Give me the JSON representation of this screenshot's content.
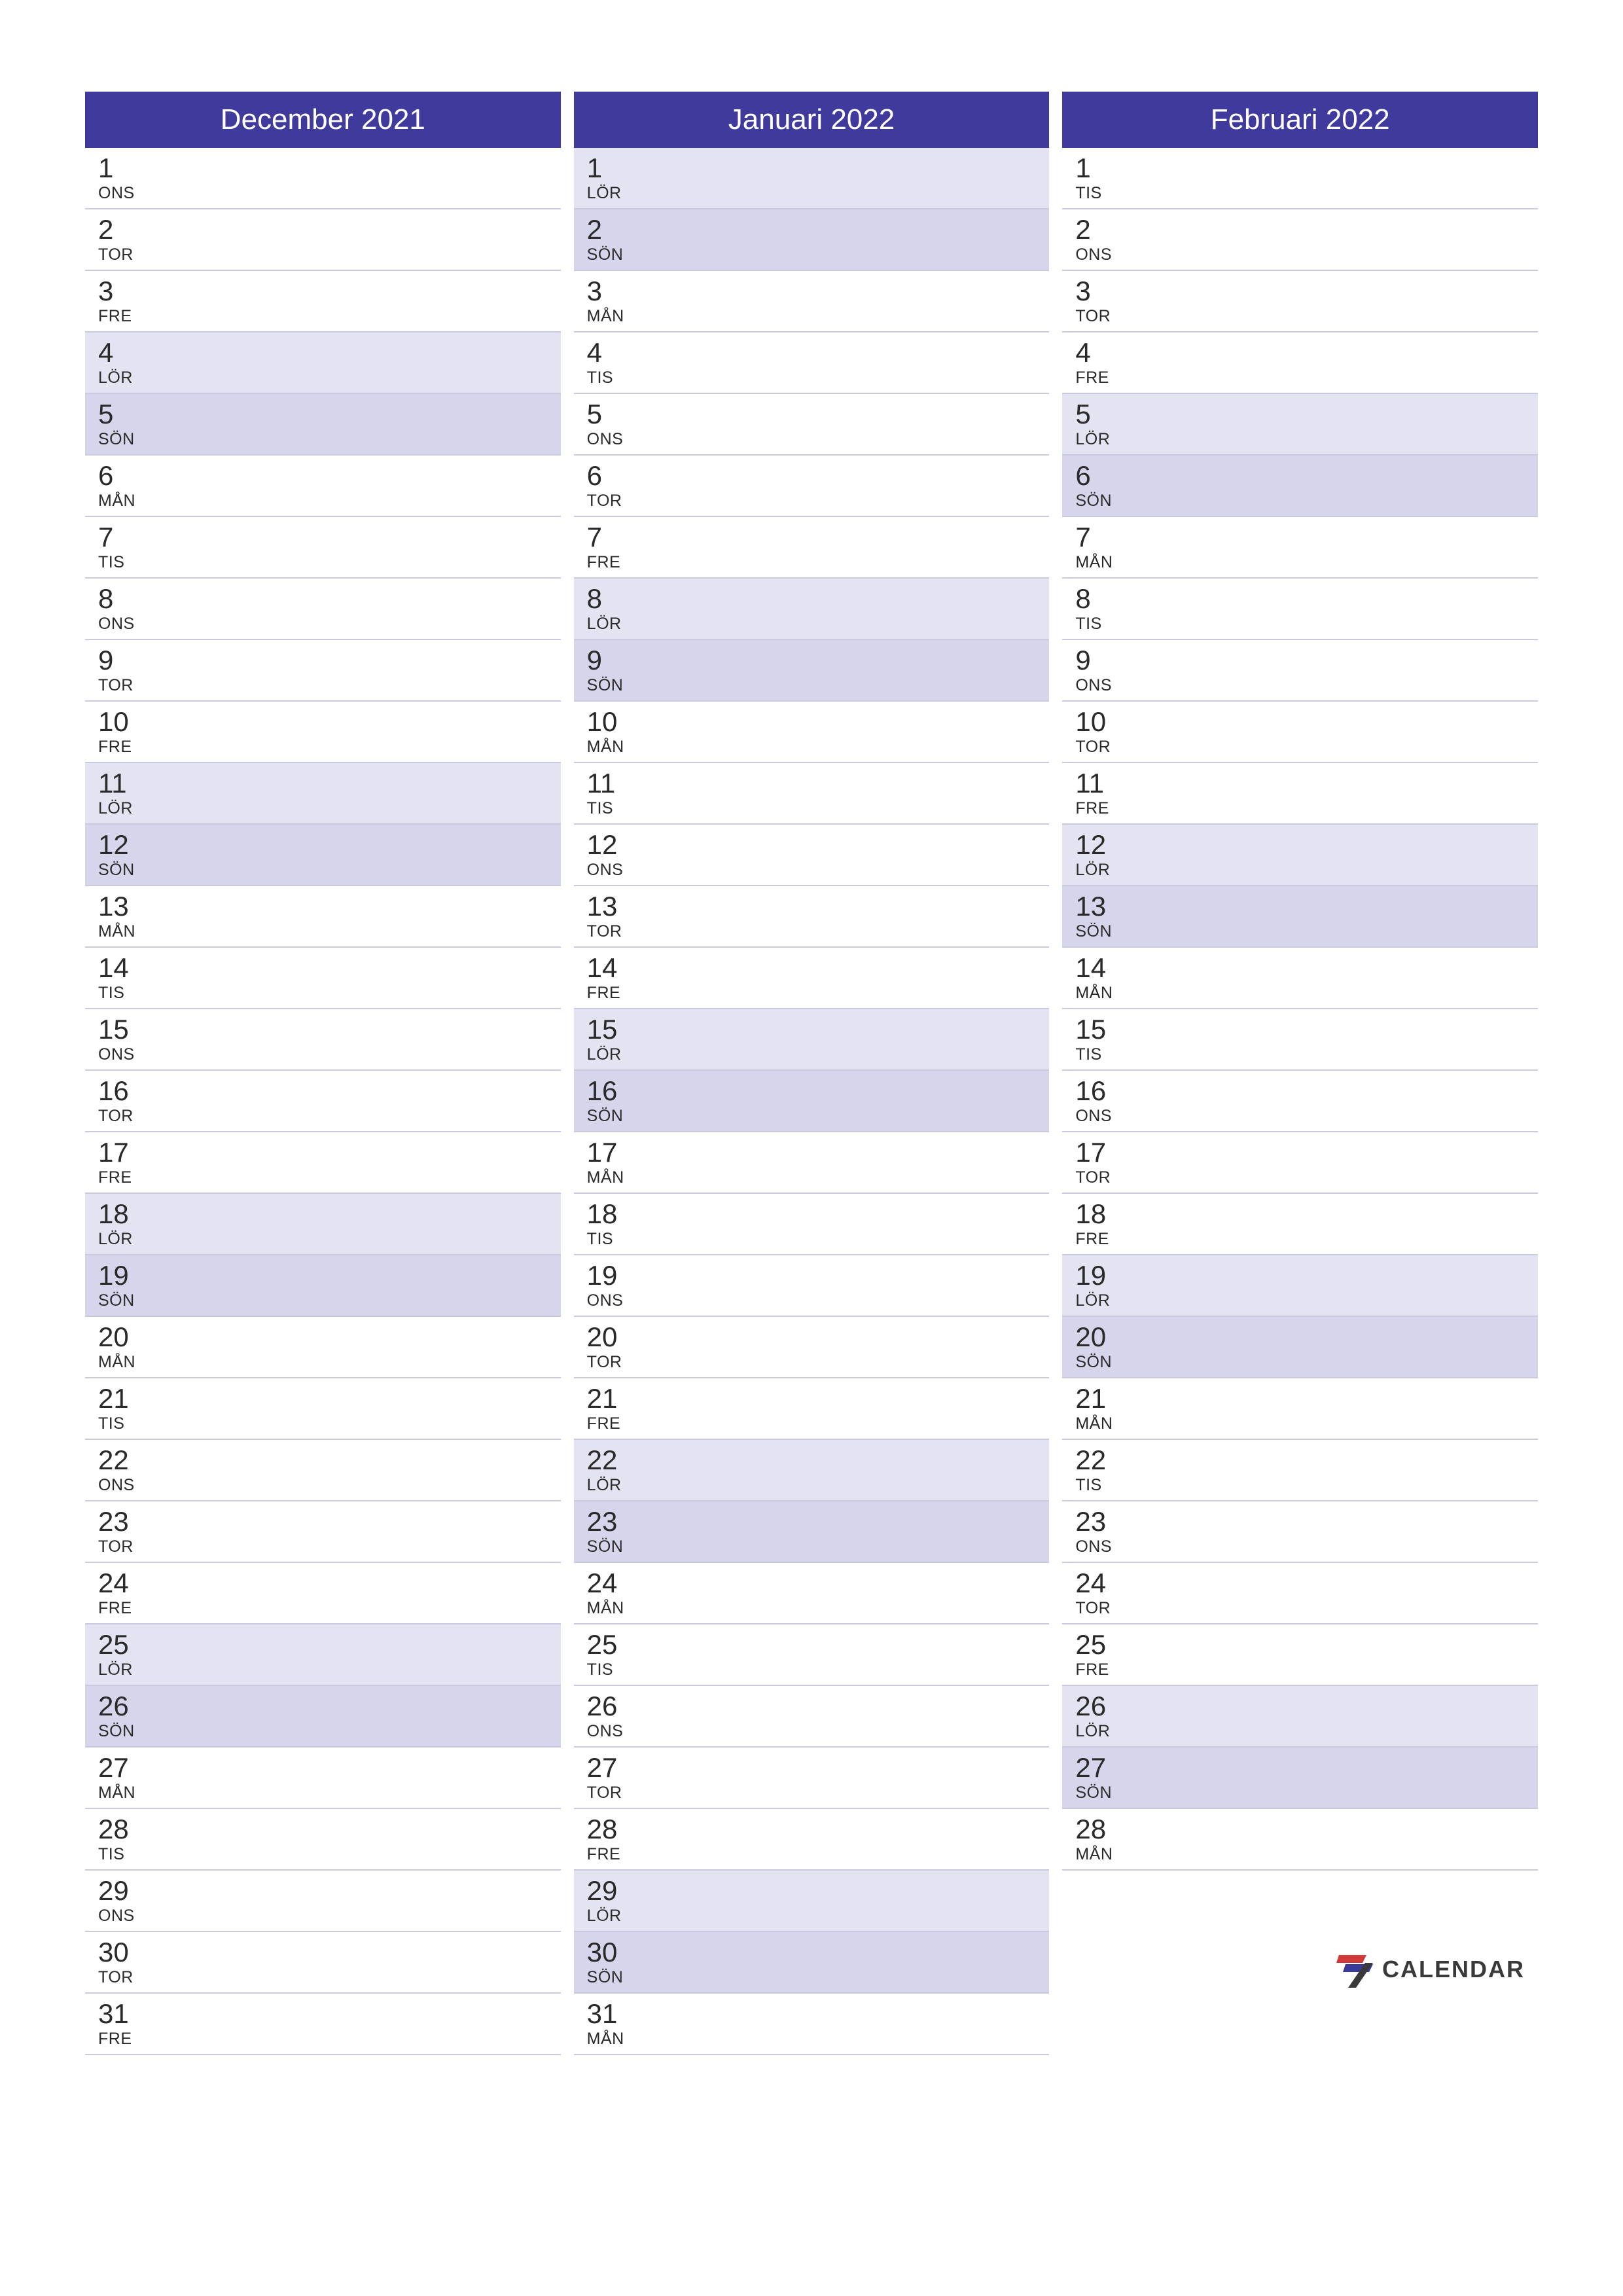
{
  "months": [
    {
      "title": "December 2021",
      "days": [
        {
          "num": "1",
          "name": "ONS",
          "type": ""
        },
        {
          "num": "2",
          "name": "TOR",
          "type": ""
        },
        {
          "num": "3",
          "name": "FRE",
          "type": ""
        },
        {
          "num": "4",
          "name": "LÖR",
          "type": "sat"
        },
        {
          "num": "5",
          "name": "SÖN",
          "type": "sun"
        },
        {
          "num": "6",
          "name": "MÅN",
          "type": ""
        },
        {
          "num": "7",
          "name": "TIS",
          "type": ""
        },
        {
          "num": "8",
          "name": "ONS",
          "type": ""
        },
        {
          "num": "9",
          "name": "TOR",
          "type": ""
        },
        {
          "num": "10",
          "name": "FRE",
          "type": ""
        },
        {
          "num": "11",
          "name": "LÖR",
          "type": "sat"
        },
        {
          "num": "12",
          "name": "SÖN",
          "type": "sun"
        },
        {
          "num": "13",
          "name": "MÅN",
          "type": ""
        },
        {
          "num": "14",
          "name": "TIS",
          "type": ""
        },
        {
          "num": "15",
          "name": "ONS",
          "type": ""
        },
        {
          "num": "16",
          "name": "TOR",
          "type": ""
        },
        {
          "num": "17",
          "name": "FRE",
          "type": ""
        },
        {
          "num": "18",
          "name": "LÖR",
          "type": "sat"
        },
        {
          "num": "19",
          "name": "SÖN",
          "type": "sun"
        },
        {
          "num": "20",
          "name": "MÅN",
          "type": ""
        },
        {
          "num": "21",
          "name": "TIS",
          "type": ""
        },
        {
          "num": "22",
          "name": "ONS",
          "type": ""
        },
        {
          "num": "23",
          "name": "TOR",
          "type": ""
        },
        {
          "num": "24",
          "name": "FRE",
          "type": ""
        },
        {
          "num": "25",
          "name": "LÖR",
          "type": "sat"
        },
        {
          "num": "26",
          "name": "SÖN",
          "type": "sun"
        },
        {
          "num": "27",
          "name": "MÅN",
          "type": ""
        },
        {
          "num": "28",
          "name": "TIS",
          "type": ""
        },
        {
          "num": "29",
          "name": "ONS",
          "type": ""
        },
        {
          "num": "30",
          "name": "TOR",
          "type": ""
        },
        {
          "num": "31",
          "name": "FRE",
          "type": ""
        }
      ]
    },
    {
      "title": "Januari 2022",
      "days": [
        {
          "num": "1",
          "name": "LÖR",
          "type": "sat"
        },
        {
          "num": "2",
          "name": "SÖN",
          "type": "sun"
        },
        {
          "num": "3",
          "name": "MÅN",
          "type": ""
        },
        {
          "num": "4",
          "name": "TIS",
          "type": ""
        },
        {
          "num": "5",
          "name": "ONS",
          "type": ""
        },
        {
          "num": "6",
          "name": "TOR",
          "type": ""
        },
        {
          "num": "7",
          "name": "FRE",
          "type": ""
        },
        {
          "num": "8",
          "name": "LÖR",
          "type": "sat"
        },
        {
          "num": "9",
          "name": "SÖN",
          "type": "sun"
        },
        {
          "num": "10",
          "name": "MÅN",
          "type": ""
        },
        {
          "num": "11",
          "name": "TIS",
          "type": ""
        },
        {
          "num": "12",
          "name": "ONS",
          "type": ""
        },
        {
          "num": "13",
          "name": "TOR",
          "type": ""
        },
        {
          "num": "14",
          "name": "FRE",
          "type": ""
        },
        {
          "num": "15",
          "name": "LÖR",
          "type": "sat"
        },
        {
          "num": "16",
          "name": "SÖN",
          "type": "sun"
        },
        {
          "num": "17",
          "name": "MÅN",
          "type": ""
        },
        {
          "num": "18",
          "name": "TIS",
          "type": ""
        },
        {
          "num": "19",
          "name": "ONS",
          "type": ""
        },
        {
          "num": "20",
          "name": "TOR",
          "type": ""
        },
        {
          "num": "21",
          "name": "FRE",
          "type": ""
        },
        {
          "num": "22",
          "name": "LÖR",
          "type": "sat"
        },
        {
          "num": "23",
          "name": "SÖN",
          "type": "sun"
        },
        {
          "num": "24",
          "name": "MÅN",
          "type": ""
        },
        {
          "num": "25",
          "name": "TIS",
          "type": ""
        },
        {
          "num": "26",
          "name": "ONS",
          "type": ""
        },
        {
          "num": "27",
          "name": "TOR",
          "type": ""
        },
        {
          "num": "28",
          "name": "FRE",
          "type": ""
        },
        {
          "num": "29",
          "name": "LÖR",
          "type": "sat"
        },
        {
          "num": "30",
          "name": "SÖN",
          "type": "sun"
        },
        {
          "num": "31",
          "name": "MÅN",
          "type": ""
        }
      ]
    },
    {
      "title": "Februari 2022",
      "days": [
        {
          "num": "1",
          "name": "TIS",
          "type": ""
        },
        {
          "num": "2",
          "name": "ONS",
          "type": ""
        },
        {
          "num": "3",
          "name": "TOR",
          "type": ""
        },
        {
          "num": "4",
          "name": "FRE",
          "type": ""
        },
        {
          "num": "5",
          "name": "LÖR",
          "type": "sat"
        },
        {
          "num": "6",
          "name": "SÖN",
          "type": "sun"
        },
        {
          "num": "7",
          "name": "MÅN",
          "type": ""
        },
        {
          "num": "8",
          "name": "TIS",
          "type": ""
        },
        {
          "num": "9",
          "name": "ONS",
          "type": ""
        },
        {
          "num": "10",
          "name": "TOR",
          "type": ""
        },
        {
          "num": "11",
          "name": "FRE",
          "type": ""
        },
        {
          "num": "12",
          "name": "LÖR",
          "type": "sat"
        },
        {
          "num": "13",
          "name": "SÖN",
          "type": "sun"
        },
        {
          "num": "14",
          "name": "MÅN",
          "type": ""
        },
        {
          "num": "15",
          "name": "TIS",
          "type": ""
        },
        {
          "num": "16",
          "name": "ONS",
          "type": ""
        },
        {
          "num": "17",
          "name": "TOR",
          "type": ""
        },
        {
          "num": "18",
          "name": "FRE",
          "type": ""
        },
        {
          "num": "19",
          "name": "LÖR",
          "type": "sat"
        },
        {
          "num": "20",
          "name": "SÖN",
          "type": "sun"
        },
        {
          "num": "21",
          "name": "MÅN",
          "type": ""
        },
        {
          "num": "22",
          "name": "TIS",
          "type": ""
        },
        {
          "num": "23",
          "name": "ONS",
          "type": ""
        },
        {
          "num": "24",
          "name": "TOR",
          "type": ""
        },
        {
          "num": "25",
          "name": "FRE",
          "type": ""
        },
        {
          "num": "26",
          "name": "LÖR",
          "type": "sat"
        },
        {
          "num": "27",
          "name": "SÖN",
          "type": "sun"
        },
        {
          "num": "28",
          "name": "MÅN",
          "type": ""
        }
      ]
    }
  ],
  "logo": {
    "text": "CALENDAR"
  }
}
